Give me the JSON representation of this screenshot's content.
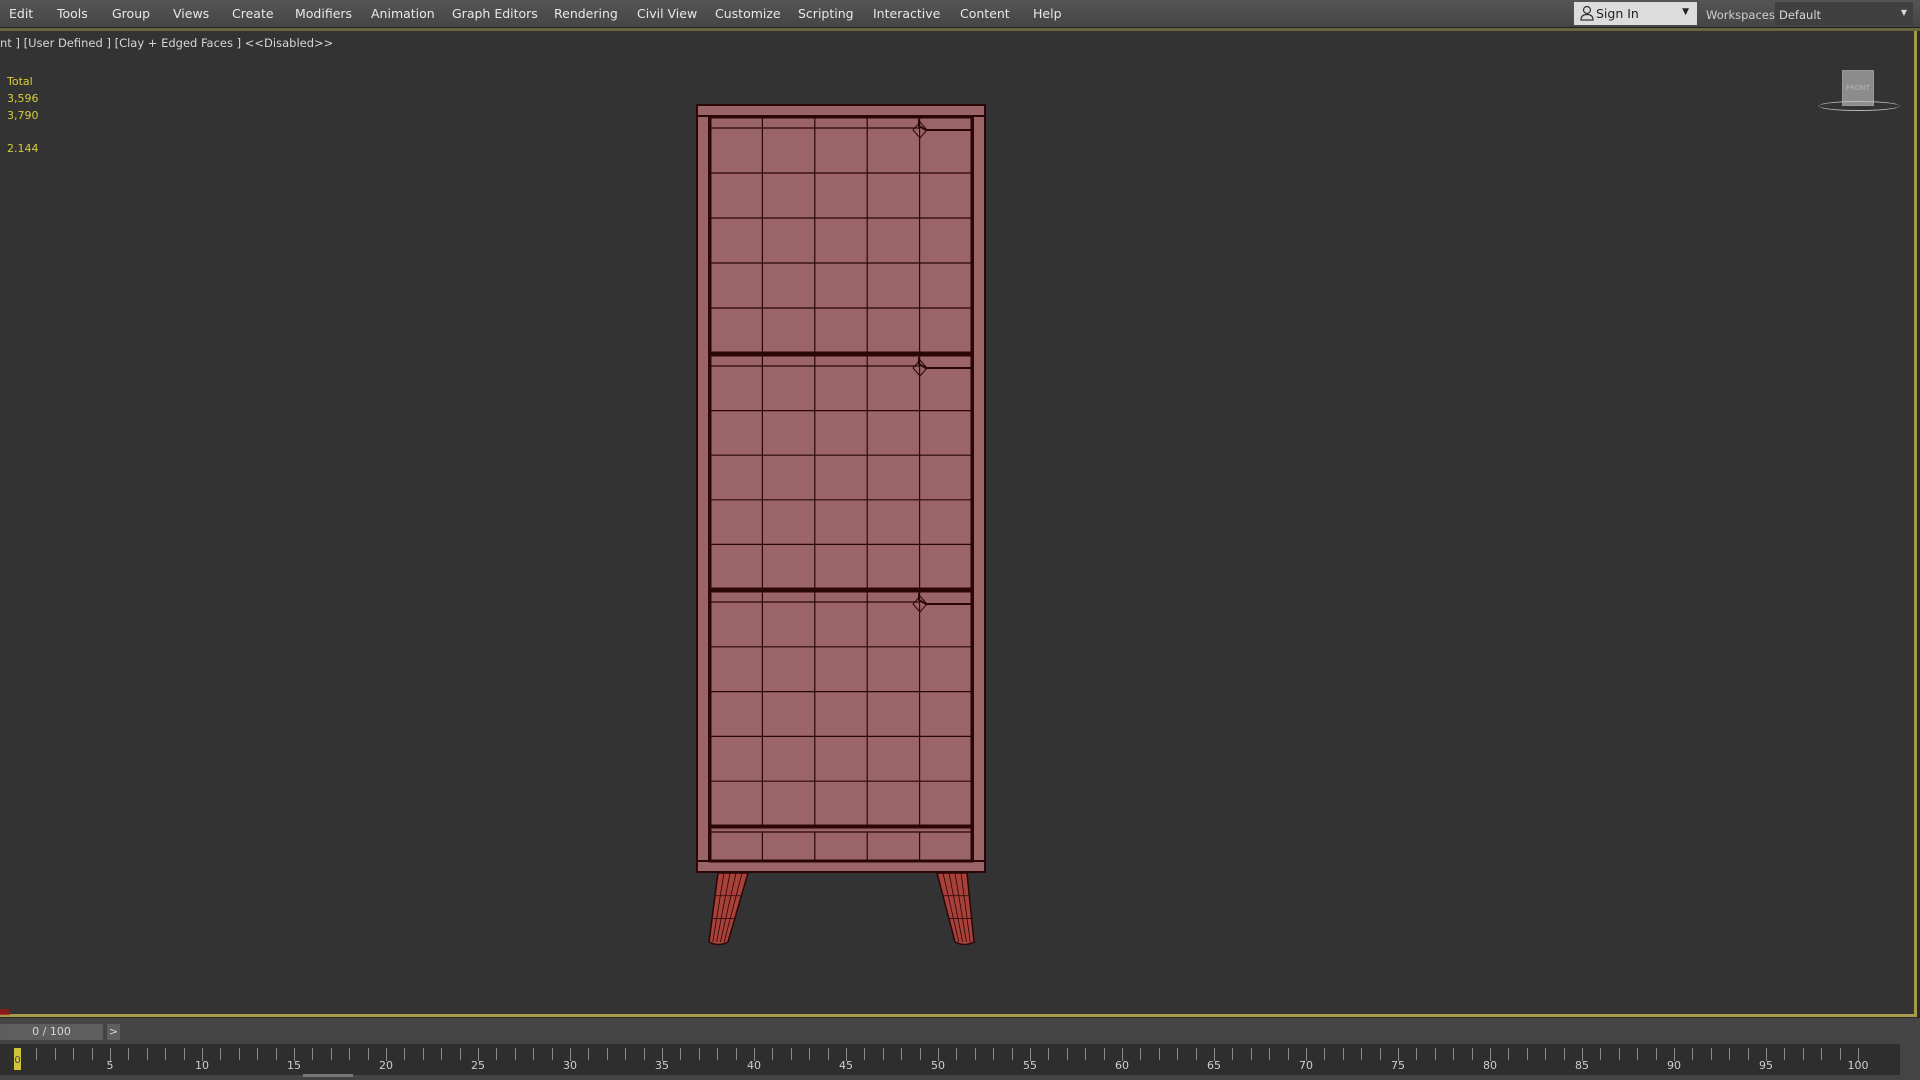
{
  "menubar": {
    "items": [
      {
        "label": "Edit"
      },
      {
        "label": "Tools"
      },
      {
        "label": "Group"
      },
      {
        "label": "Views"
      },
      {
        "label": "Create"
      },
      {
        "label": "Modifiers"
      },
      {
        "label": "Animation"
      },
      {
        "label": "Graph Editors"
      },
      {
        "label": "Rendering"
      },
      {
        "label": "Civil View"
      },
      {
        "label": "Customize"
      },
      {
        "label": "Scripting"
      },
      {
        "label": "Interactive"
      },
      {
        "label": "Content"
      },
      {
        "label": "Help"
      }
    ],
    "sign_in": {
      "label": "Sign In",
      "icon": "user-icon"
    },
    "workspaces": {
      "label": "Workspaces:",
      "value": "Default"
    }
  },
  "viewport": {
    "label": "nt ] [User Defined ] [Clay + Edged Faces ]  <<Disabled>>",
    "stats": {
      "header": "Total",
      "polys": "3,596",
      "verts": "3,790",
      "fps": "2.144"
    },
    "viewcube_face": "FRONT",
    "model": {
      "name": "cabinet",
      "face_color": "#9b6567",
      "edge_color": "#2a0606",
      "leg_color": "#a8413a",
      "drawers": 3,
      "grid_columns": 5
    }
  },
  "timeline": {
    "slider_label": "0 / 100",
    "next_label": ">",
    "current_frame": "0",
    "start": 0,
    "end": 100,
    "major_labels": [
      "5",
      "10",
      "15",
      "20",
      "25",
      "30",
      "35",
      "40",
      "45",
      "50",
      "55",
      "60",
      "65",
      "70",
      "75",
      "80",
      "85",
      "90",
      "95",
      "100"
    ]
  },
  "colors": {
    "active_border": "#a59a4a",
    "stat_text": "#d9cc3a",
    "viewport_bg": "#333333"
  }
}
